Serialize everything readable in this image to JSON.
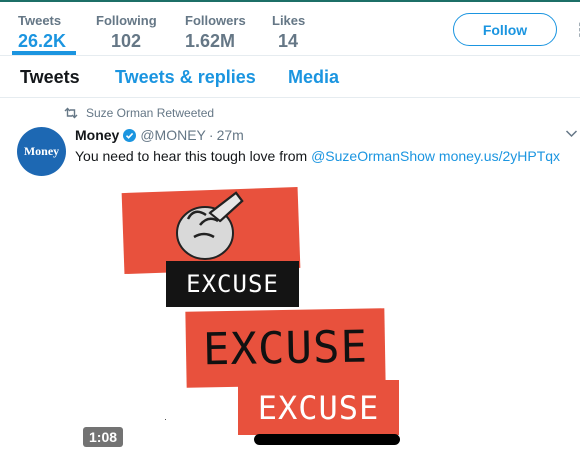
{
  "stats": [
    {
      "label": "Tweets",
      "value": "26.2K"
    },
    {
      "label": "Following",
      "value": "102"
    },
    {
      "label": "Followers",
      "value": "1.62M"
    },
    {
      "label": "Likes",
      "value": "14"
    }
  ],
  "follow_label": "Follow",
  "tabs": [
    "Tweets",
    "Tweets & replies",
    "Media"
  ],
  "retweet_note": "Suze Orman Retweeted",
  "tweet": {
    "avatar_text": "Money",
    "name": "Money",
    "handle": "@MONEY",
    "separator": "·",
    "time": "27m",
    "text": "You need to hear this tough love from ",
    "mention": "@SuzeOrmanShow",
    "url": "money.us/2yHPTqx"
  },
  "media": {
    "words": [
      "EXCUSE",
      "EXCUSE",
      "EXCUSE"
    ],
    "duration": "1:08"
  },
  "colors": {
    "accent": "#1b95e0",
    "panel_red": "#e8513d",
    "avatar_blue": "#1d68b3"
  },
  "icons": [
    "retweet-icon",
    "verified-icon",
    "chevron-down-icon",
    "more-icon",
    "pointing-hand-icon"
  ]
}
